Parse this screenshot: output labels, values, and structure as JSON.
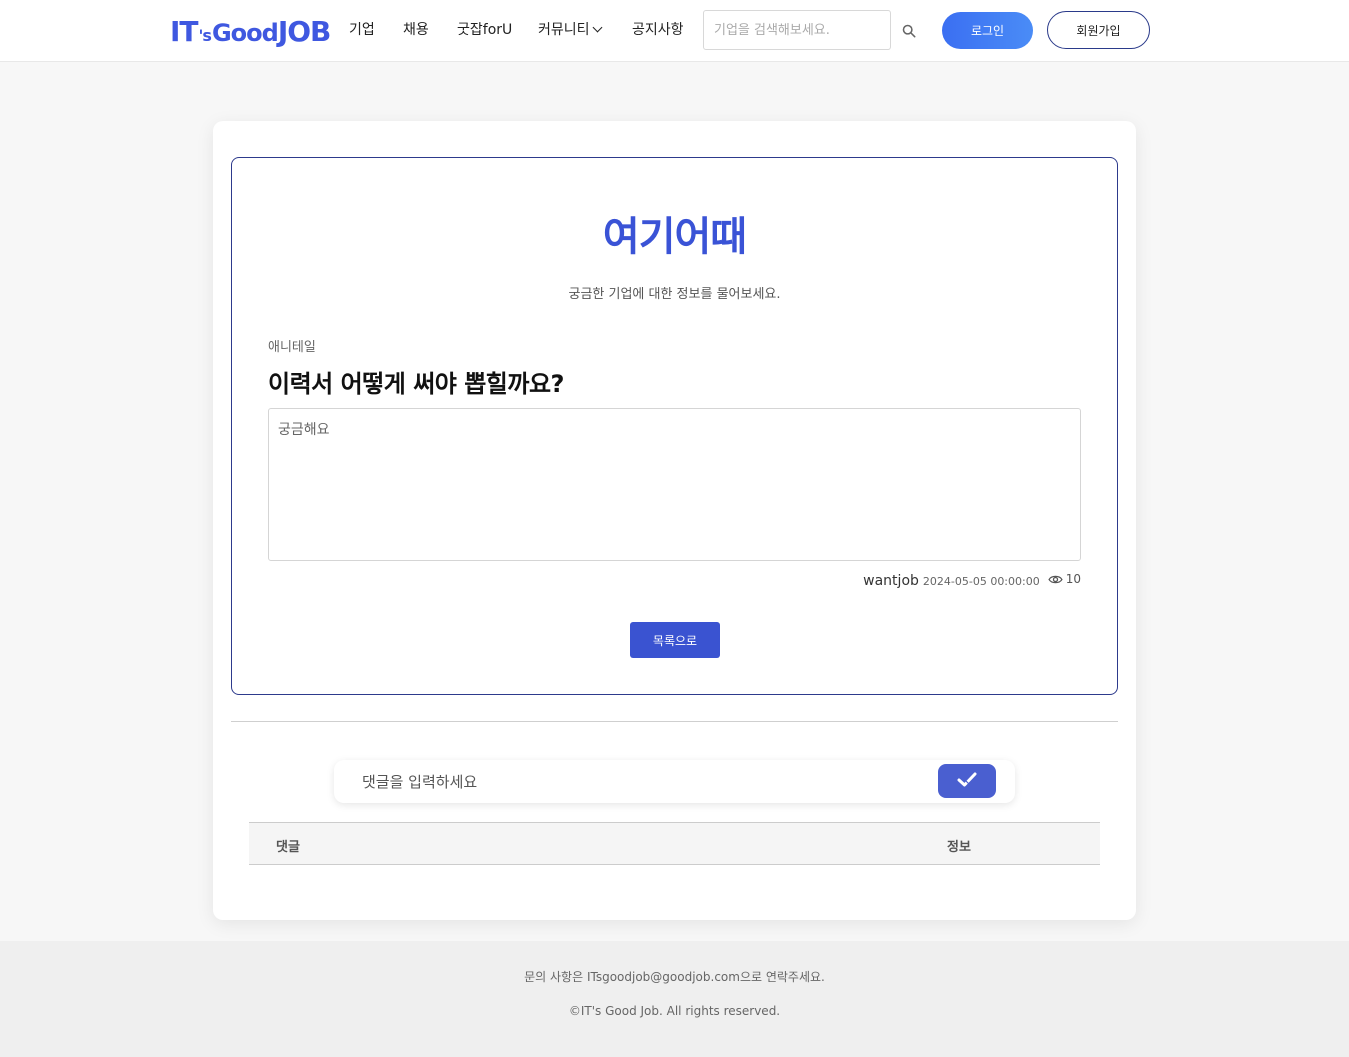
{
  "header": {
    "logo": {
      "part1": "IT",
      "part2": "'s",
      "part3": "Good",
      "part4": "JOB"
    },
    "nav": [
      {
        "label": "기업"
      },
      {
        "label": "채용"
      },
      {
        "label": "굿잡forU"
      },
      {
        "label": "커뮤니티",
        "has_dropdown": true
      },
      {
        "label": "공지사항"
      }
    ],
    "search_placeholder": "기업을 검색해보세요.",
    "login_label": "로그인",
    "signup_label": "회원가입"
  },
  "board": {
    "title": "여기어때",
    "subtitle": "궁금한 기업에 대한 정보를 물어보세요."
  },
  "post": {
    "company": "애니테일",
    "title": "이력서 어떻게 써야 뽑힐까요?",
    "content": "궁금해요",
    "author": "wantjob",
    "date": "2024-05-05 00:00:00",
    "views": "10"
  },
  "list_button_label": "목록으로",
  "comment": {
    "placeholder": "댓글을 입력하세요",
    "table_headers": {
      "comment": "댓글",
      "info": "정보"
    }
  },
  "footer": {
    "contact": "문의 사항은 ITsgoodjob@goodjob.com으로 연락주세요.",
    "copyright": "©IT's Good Job. All rights reserved."
  },
  "colors": {
    "brand": "#3a53d6",
    "primary_button": "#3a53d1",
    "login_gradient_start": "#3b6ff2",
    "login_gradient_end": "#4a8cf6"
  },
  "icons": [
    "search-icon",
    "chevron-down-icon",
    "eye-icon",
    "check-icon"
  ]
}
